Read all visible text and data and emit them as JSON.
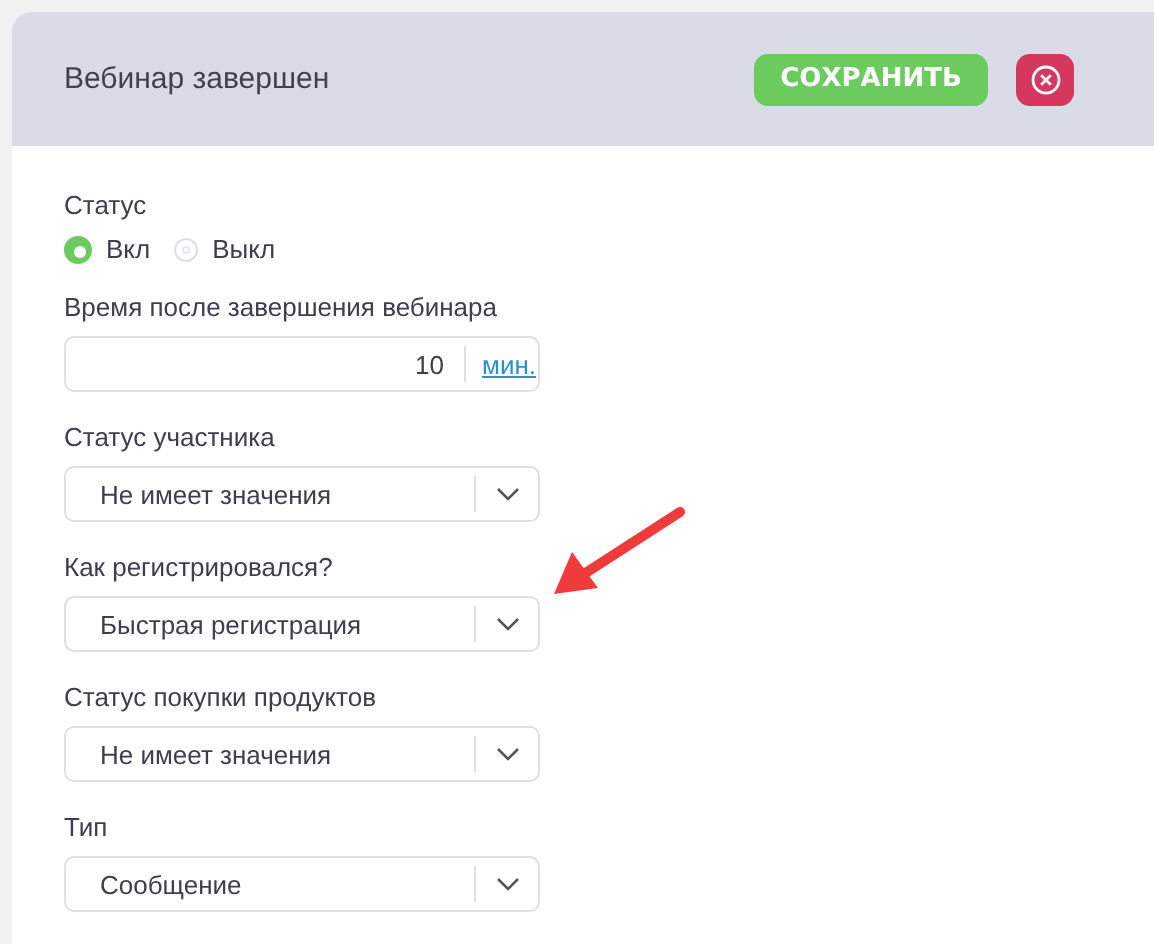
{
  "header": {
    "title": "Вебинар завершен",
    "save_button": "СОХРАНИТЬ"
  },
  "status": {
    "label": "Статус",
    "options": [
      {
        "label": "Вкл",
        "selected": true
      },
      {
        "label": "Выкл",
        "selected": false
      }
    ]
  },
  "fields": [
    {
      "kind": "number",
      "label": "Время после завершения вебинара",
      "value": "10",
      "unit": "мин."
    },
    {
      "kind": "select",
      "label": "Статус участника",
      "value": "Не имеет значения"
    },
    {
      "kind": "select",
      "label": "Как регистрировался?",
      "value": "Быстрая регистрация"
    },
    {
      "kind": "select",
      "label": "Статус покупки продуктов",
      "value": "Не имеет значения"
    },
    {
      "kind": "select",
      "label": "Тип",
      "value": "Сообщение"
    }
  ]
}
